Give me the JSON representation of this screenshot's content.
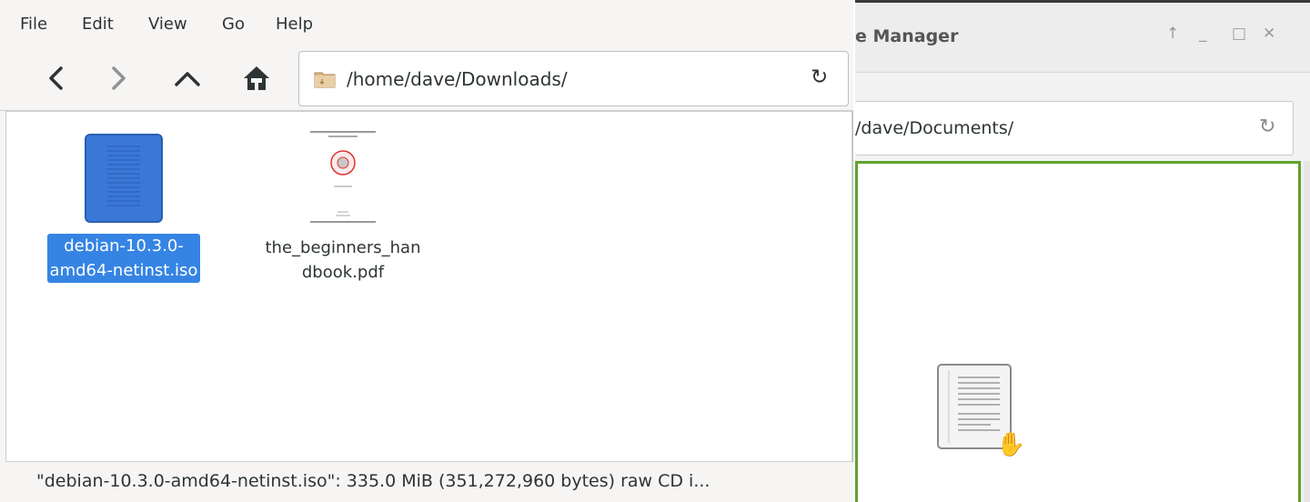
{
  "background_window": {
    "title": "e Manager",
    "controls": {
      "up": "↑",
      "minimize": "_",
      "maximize": "□",
      "close": "✕"
    },
    "path": "/dave/Documents/",
    "refresh_icon": "refresh-icon",
    "content": {
      "dragged_item": "document-icon",
      "cursor": "grab-hand-icon"
    },
    "accent_color": "#5fa32e"
  },
  "menubar": {
    "file": "File",
    "edit": "Edit",
    "view": "View",
    "go": "Go",
    "help": "Help"
  },
  "toolbar": {
    "back_icon": "chevron-left-icon",
    "forward_icon": "chevron-right-icon",
    "up_icon": "chevron-up-icon",
    "home_icon": "home-icon",
    "location": "/home/dave/Downloads/",
    "reload_icon": "refresh-icon"
  },
  "files": [
    {
      "name_line1": "debian-10.3.0-",
      "name_line2": "amd64-netinst.iso",
      "icon": "disc-image-icon",
      "selected": true
    },
    {
      "name_line1": "the_beginners_han",
      "name_line2": "dbook.pdf",
      "icon": "pdf-thumbnail-icon",
      "selected": false
    }
  ],
  "status": "\"debian-10.3.0-amd64-netinst.iso\": 335.0 MiB (351,272,960 bytes) raw CD i...",
  "colors": {
    "selection": "#3584e4",
    "iso_icon": "#3a78d8",
    "drop_target_border": "#5fa32e"
  }
}
